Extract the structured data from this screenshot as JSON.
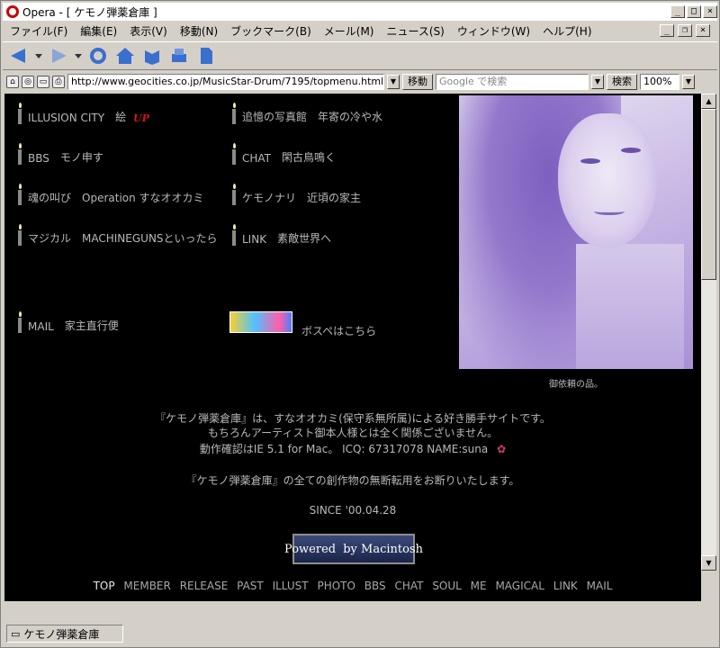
{
  "window": {
    "title": "Opera - [ ケモノ弾薬倉庫 ]"
  },
  "menu": {
    "items": [
      "ファイル(F)",
      "編集(E)",
      "表示(V)",
      "移動(N)",
      "ブックマーク(B)",
      "メール(M)",
      "ニュース(S)",
      "ウィンドウ(W)",
      "ヘルプ(H)"
    ]
  },
  "addressbar": {
    "url": "http://www.geocities.co.jp/MusicStar-Drum/7195/topmenu.html",
    "go_label": "移動",
    "search_placeholder": "Google で検索",
    "search_label": "検索",
    "zoom": "100%"
  },
  "nav_left": [
    {
      "label": "ILLUSION CITY",
      "desc": "絵"
    },
    {
      "label": "BBS",
      "desc": "モノ申す"
    },
    {
      "label": "魂の叫び",
      "desc": "Operation すなオオカミ"
    },
    {
      "label": "マジカル",
      "desc": "MACHINEGUNSといったら"
    },
    {
      "label": "MAIL",
      "desc": "家主直行便"
    }
  ],
  "nav_right": [
    {
      "label": "追憶の写真館",
      "desc": "年寄の冷や水"
    },
    {
      "label": "CHAT",
      "desc": "閑古鳥鳴く"
    },
    {
      "label": "ケモノナリ",
      "desc": "近頃の家主"
    },
    {
      "label": "LINK",
      "desc": "素敵世界へ"
    }
  ],
  "up_mark": "UP",
  "bospet_text": "ボスペはこちら",
  "portrait_caption": "御依頼の品。",
  "intro": {
    "line1": "『ケモノ弾薬倉庫』は、すなオオカミ(保守系無所属)による好き勝手サイトです。",
    "line2": "もちろんアーティスト御本人様とは全く関係ございません。",
    "line3": "動作確認はIE 5.1 for Mac。 ICQ: 67317078 NAME:suna",
    "notice": "『ケモノ弾薬倉庫』の全ての創作物の無断転用をお断りいたします。",
    "since": "SINCE '00.04.28"
  },
  "mac_badge": {
    "left": "Powered",
    "mid": "by",
    "right": "Macintosh"
  },
  "bottom_nav": [
    "TOP",
    "MEMBER",
    "RELEASE",
    "PAST",
    "ILLUST",
    "PHOTO",
    "BBS",
    "CHAT",
    "SOUL",
    "ME",
    "MAGICAL",
    "LINK",
    "MAIL"
  ],
  "status": {
    "tab_title": "ケモノ弾薬倉庫"
  }
}
